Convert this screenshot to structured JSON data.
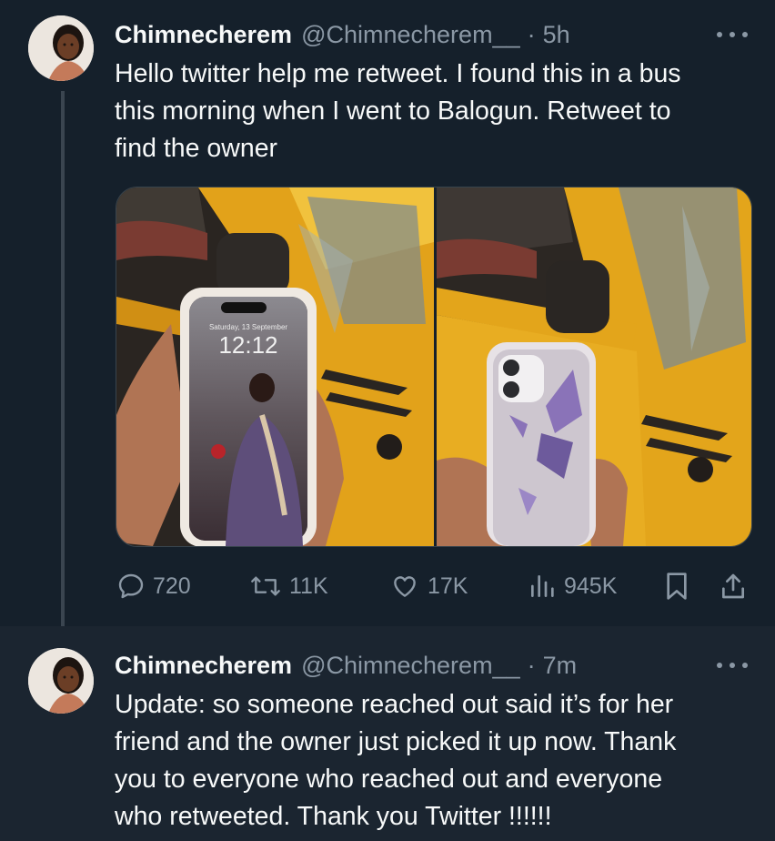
{
  "tweet1": {
    "display_name": "Chimnecherem",
    "handle": "@Chimnecherem__",
    "separator": "·",
    "time": "5h",
    "text_lines": [
      "Hello twitter help me retweet. I found this in a bus",
      "this morning when I went to Balogun. Retweet to",
      "find the owner"
    ],
    "media": {
      "photo1": {
        "lockscreen_date": "Saturday, 13 September",
        "lockscreen_time": "12:12"
      }
    },
    "actions": {
      "replies": "720",
      "retweets": "11K",
      "likes": "17K",
      "views": "945K"
    }
  },
  "tweet2": {
    "display_name": "Chimnecherem",
    "handle": "@Chimnecherem__",
    "separator": "·",
    "time": "7m",
    "text_lines": [
      "Update: so someone reached out said it’s for her",
      "friend and the owner just picked it up now. Thank",
      "you to everyone who reached out and everyone",
      "who retweeted. Thank you Twitter !!!!!!"
    ]
  },
  "icons": [
    "more-icon",
    "reply-icon",
    "retweet-icon",
    "like-icon",
    "views-icon",
    "bookmark-icon",
    "share-icon"
  ],
  "colors": {
    "background": "#15202b",
    "secondary_text": "#8b98a5",
    "bus_yellow": "#e6a817"
  }
}
